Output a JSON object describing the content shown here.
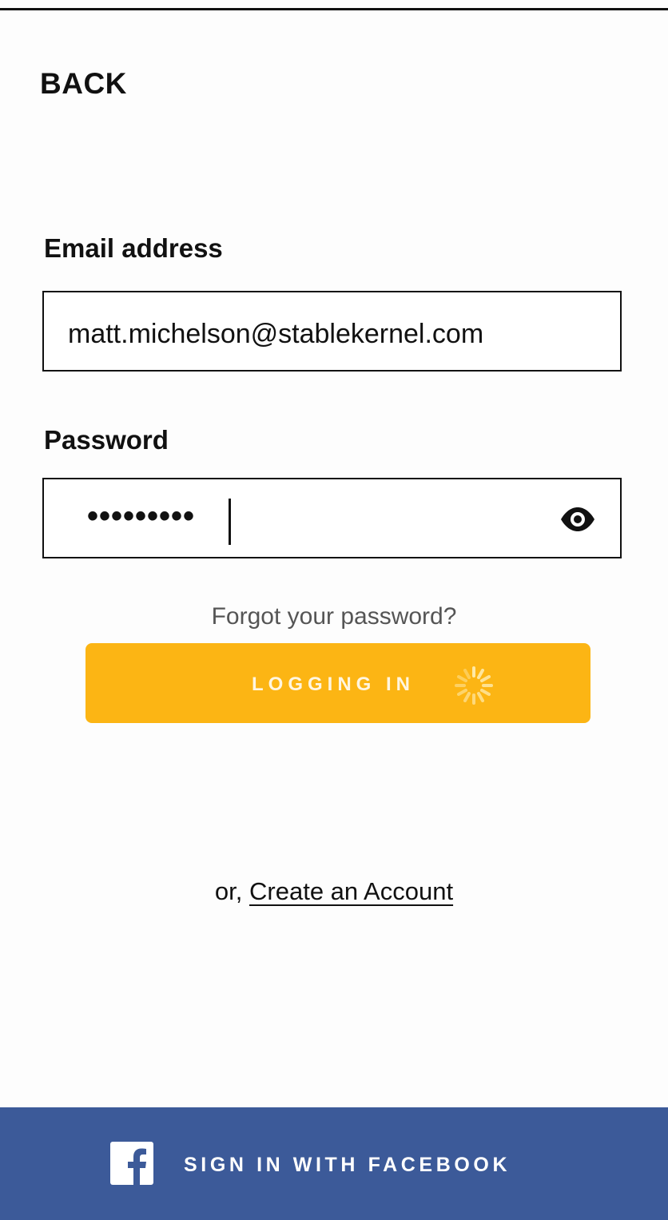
{
  "header": {
    "back_label": "BACK"
  },
  "form": {
    "email_label": "Email address",
    "email_value": "matt.michelson@stablekernel.com",
    "password_label": "Password",
    "password_mask": "•••••••••"
  },
  "links": {
    "forgot_password": "Forgot your password?",
    "create_prefix": "or, ",
    "create_account": "Create an Account"
  },
  "login_button": {
    "label": "LOGGING IN",
    "color": "#fcb514",
    "state": "loading"
  },
  "facebook": {
    "label": "SIGN IN WITH FACEBOOK",
    "color": "#3c5a99"
  },
  "icons": {
    "password_toggle": "eye-icon",
    "spinner": "spinner-icon",
    "facebook": "facebook-icon"
  }
}
